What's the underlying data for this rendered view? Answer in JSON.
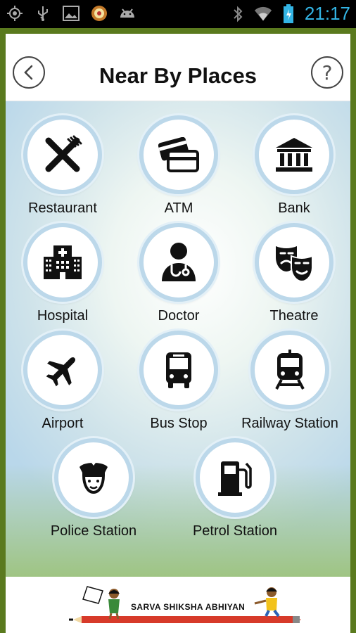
{
  "status_bar": {
    "time": "21:17",
    "left_icons": [
      "gps-icon",
      "usb-icon",
      "gallery-icon",
      "app-badge-icon",
      "android-icon"
    ],
    "right_icons": [
      "bluetooth-icon",
      "wifi-icon",
      "battery-icon"
    ]
  },
  "header": {
    "title": "Near By Places",
    "back_icon": "chevron-left-icon",
    "help_label": "?"
  },
  "places": [
    {
      "id": "restaurant",
      "label": "Restaurant",
      "icon": "fork-knife-icon"
    },
    {
      "id": "atm",
      "label": "ATM",
      "icon": "cards-icon"
    },
    {
      "id": "bank",
      "label": "Bank",
      "icon": "bank-building-icon"
    },
    {
      "id": "hospital",
      "label": "Hospital",
      "icon": "hospital-building-icon"
    },
    {
      "id": "doctor",
      "label": "Doctor",
      "icon": "doctor-icon"
    },
    {
      "id": "theatre",
      "label": "Theatre",
      "icon": "theatre-masks-icon"
    },
    {
      "id": "airport",
      "label": "Airport",
      "icon": "airplane-icon"
    },
    {
      "id": "bus-stop",
      "label": "Bus Stop",
      "icon": "bus-icon"
    },
    {
      "id": "railway-station",
      "label": "Railway Station",
      "icon": "train-icon"
    },
    {
      "id": "police-station",
      "label": "Police Station",
      "icon": "police-officer-icon"
    },
    {
      "id": "petrol-station",
      "label": "Petrol Station",
      "icon": "fuel-pump-icon"
    }
  ],
  "footer": {
    "banner_text": "SARVA SHIKSHA ABHIYAN"
  },
  "colors": {
    "frame": "#5a7a1e",
    "circle_border": "#bcd8ea",
    "time": "#33b5e5"
  }
}
